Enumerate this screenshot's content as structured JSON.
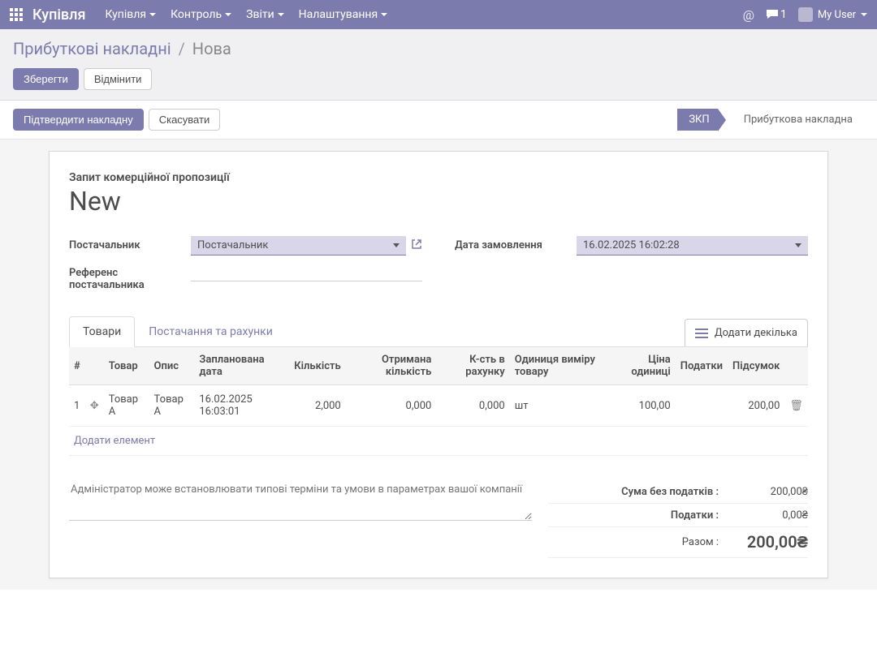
{
  "navbar": {
    "title": "Купівля",
    "menu": [
      "Купівля",
      "Контроль",
      "Звіти",
      "Налаштування"
    ],
    "chat_count": "1",
    "user": "My User"
  },
  "breadcrumb": {
    "parent": "Прибуткові накладні",
    "current": "Нова"
  },
  "cp_buttons": {
    "save": "Зберегти",
    "discard": "Відмінити"
  },
  "statusbar": {
    "confirm": "Підтвердити накладну",
    "cancel": "Скасувати",
    "status_active": "ЗКП",
    "status_inactive": "Прибуткова накладна"
  },
  "sheet": {
    "subtitle": "Запит комерційної пропозиції",
    "title": "New",
    "labels": {
      "vendor": "Постачальник",
      "vendor_ref": "Референс постачальника",
      "order_date": "Дата замовлення"
    },
    "fields": {
      "vendor": "Постачальник",
      "vendor_ref": "",
      "order_date": "16.02.2025 16:02:28"
    }
  },
  "tabs": {
    "products": "Товари",
    "delivery": "Постачання та рахунки",
    "add_multi": "Додати декілька"
  },
  "columns": {
    "seq": "#",
    "product": "Товар",
    "desc": "Опис",
    "planned": "Запланована дата",
    "qty": "Кількість",
    "received": "Отримана кількість",
    "billed": "К-сть в рахунку",
    "uom": "Одиниця виміру товару",
    "price": "Ціна одиниці",
    "taxes": "Податки",
    "subtotal": "Підсумок"
  },
  "lines": [
    {
      "seq": "1",
      "product": "Товар А",
      "desc": "Товар А",
      "planned": "16.02.2025 16:03:01",
      "qty": "2,000",
      "received": "0,000",
      "billed": "0,000",
      "uom": "шт",
      "price": "100,00",
      "taxes": "",
      "subtotal": "200,00"
    }
  ],
  "add_line": "Додати елемент",
  "note_placeholder": "Адміністратор може встановлювати типові терміни та умови в параметрах вашої компанії",
  "totals": {
    "untaxed_label": "Сума без податків :",
    "untaxed_value": "200,00₴",
    "taxes_label": "Податки :",
    "taxes_value": "0,00₴",
    "total_label": "Разом :",
    "total_value": "200,00₴"
  }
}
